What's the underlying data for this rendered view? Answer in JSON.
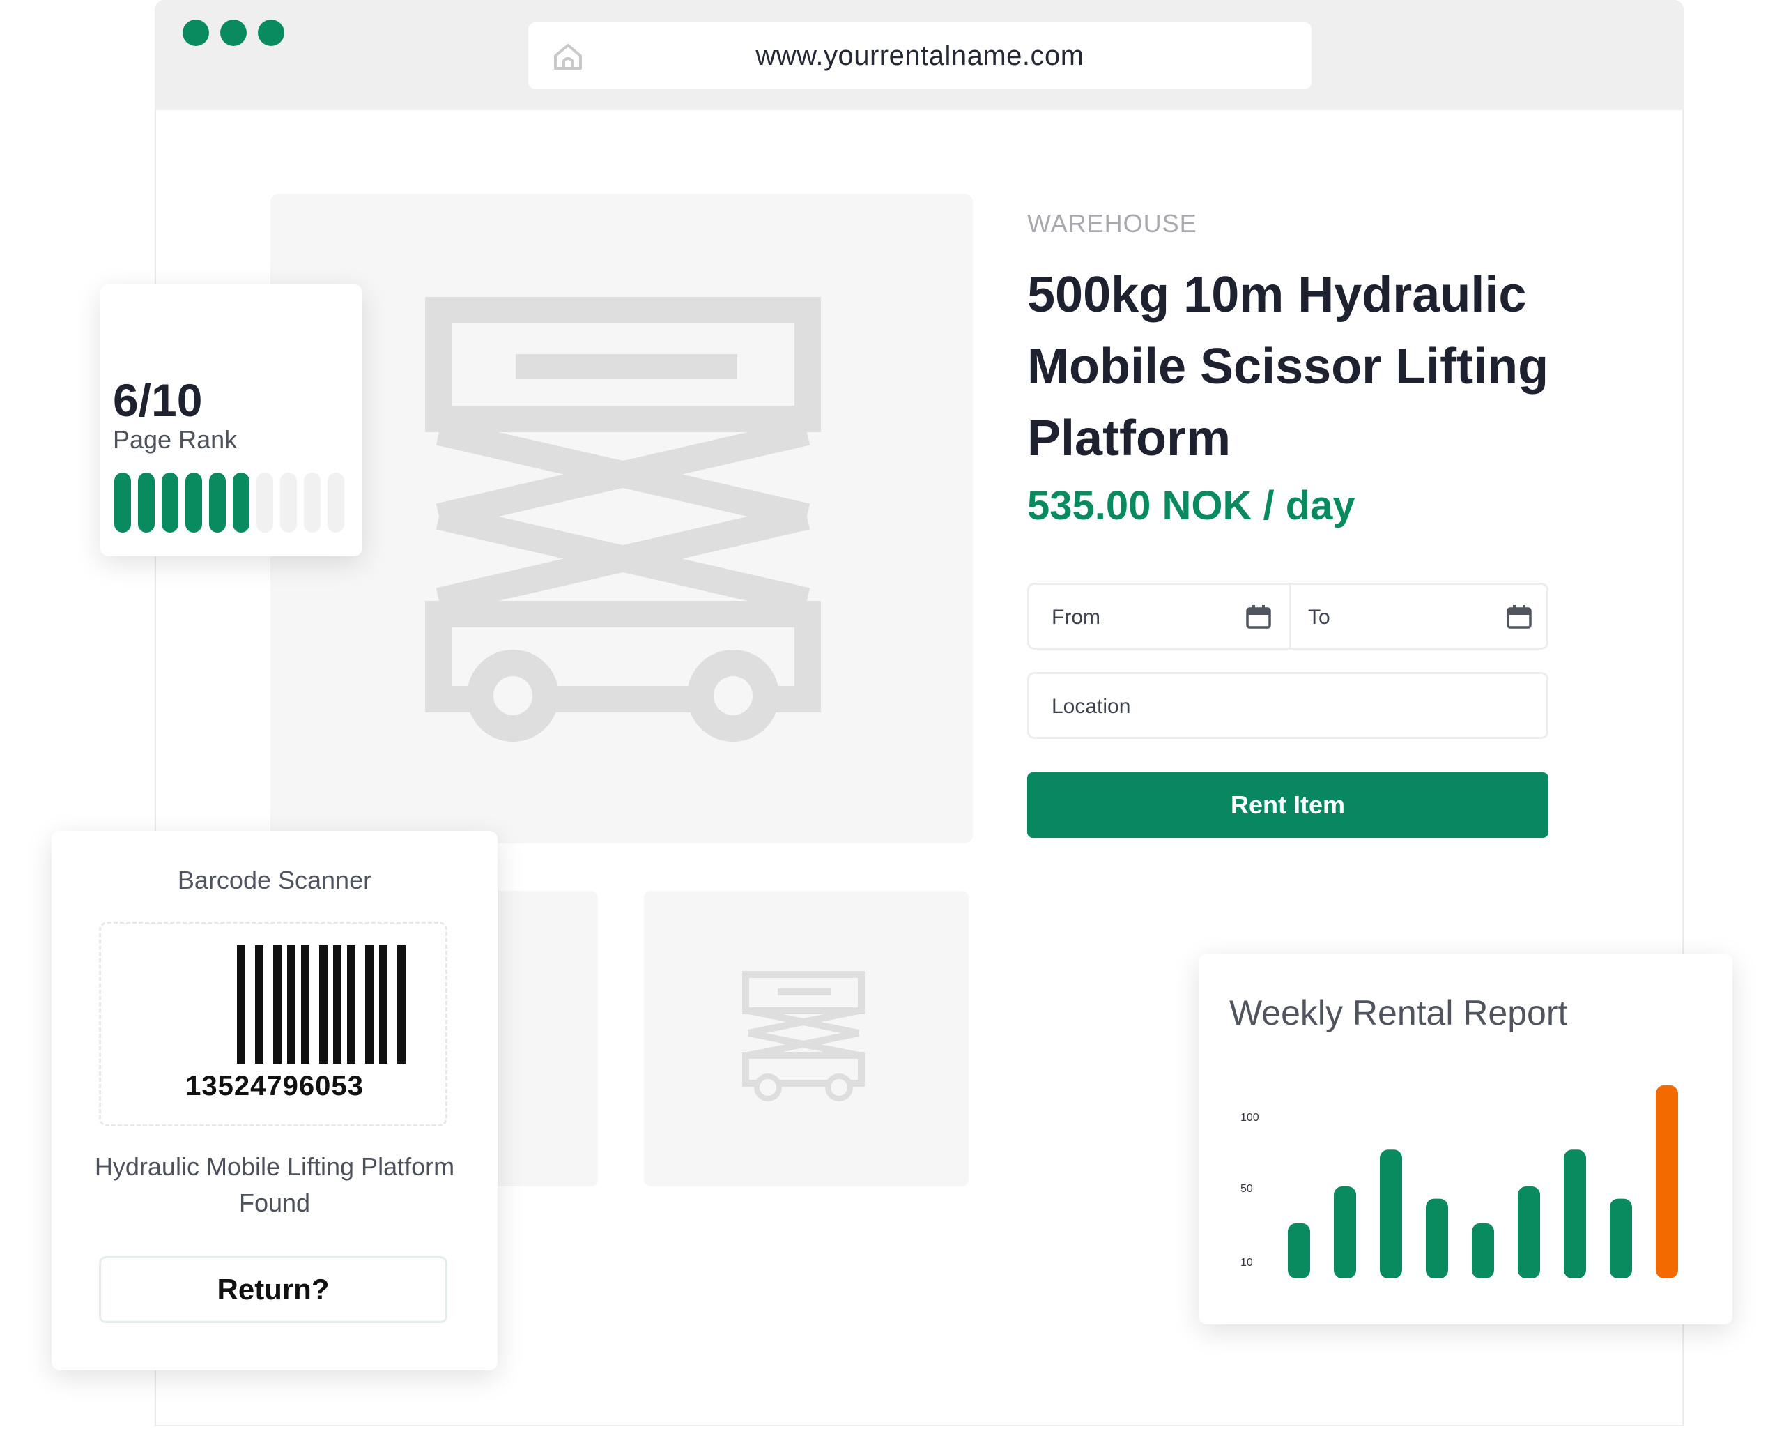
{
  "browser": {
    "url": "www.yourrentalname.com",
    "accent_color": "#0a8a5f"
  },
  "product": {
    "category": "WAREHOUSE",
    "title": "500kg 10m Hydraulic Mobile Scissor Lifting Platform",
    "price": "535.00 NOK / day",
    "from_placeholder": "From",
    "to_placeholder": "To",
    "location_placeholder": "Location",
    "rent_button_label": "Rent Item",
    "price_color": "#0a8a5f"
  },
  "page_rank": {
    "value_text": "6/10",
    "label": "Page Rank",
    "score": 6,
    "max": 10
  },
  "barcode_scanner": {
    "title": "Barcode Scanner",
    "code": "13524796053",
    "message": "Hydraulic Mobile Lifting Platform Found",
    "return_button_label": "Return?"
  },
  "weekly_report": {
    "title": "Weekly Rental Report",
    "chart_data": {
      "type": "bar",
      "title": "Weekly Rental Report",
      "y_ticks": [
        "100",
        "50",
        "10"
      ],
      "values": [
        36,
        60,
        84,
        52,
        36,
        60,
        84,
        52,
        126
      ],
      "colors": [
        "#0a8a5f",
        "#0a8a5f",
        "#0a8a5f",
        "#0a8a5f",
        "#0a8a5f",
        "#0a8a5f",
        "#0a8a5f",
        "#0a8a5f",
        "#f26a00"
      ],
      "grid": false
    }
  }
}
